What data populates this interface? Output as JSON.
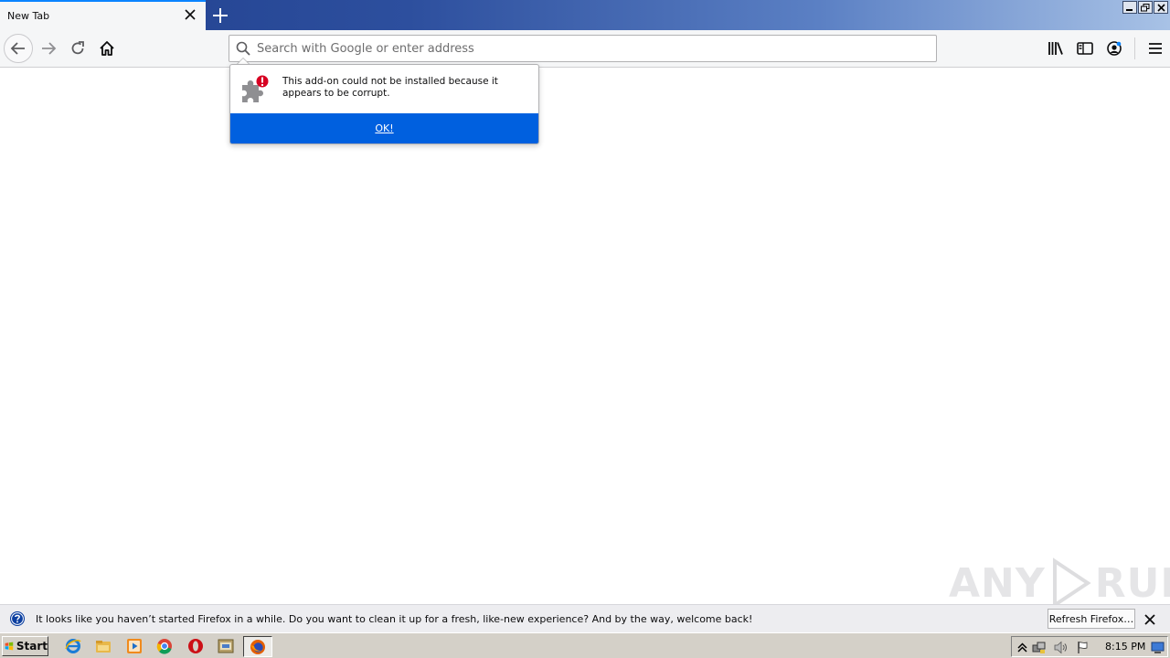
{
  "browser": {
    "tab_title": "New Tab",
    "url_placeholder": "Search with Google or enter address"
  },
  "popup": {
    "message": "This add-on could not be installed because it appears to be corrupt.",
    "ok_label": "OK!"
  },
  "watermark": {
    "left": "ANY",
    "right": "RUN"
  },
  "notification": {
    "text": "It looks like you haven’t started Firefox in a while. Do you want to clean it up for a fresh, like-new experience? And by the way, welcome back!",
    "button_label": "Refresh Firefox…"
  },
  "taskbar": {
    "start_label": "Start",
    "clock": "8:15 PM",
    "apps": [
      "ie-icon",
      "explorer-icon",
      "media-player-icon",
      "chrome-icon",
      "opera-icon",
      "program-icon",
      "firefox-icon"
    ]
  },
  "colors": {
    "accent_blue": "#0060df",
    "tab_highlight": "#0a84ff",
    "alert_red": "#d70022"
  }
}
